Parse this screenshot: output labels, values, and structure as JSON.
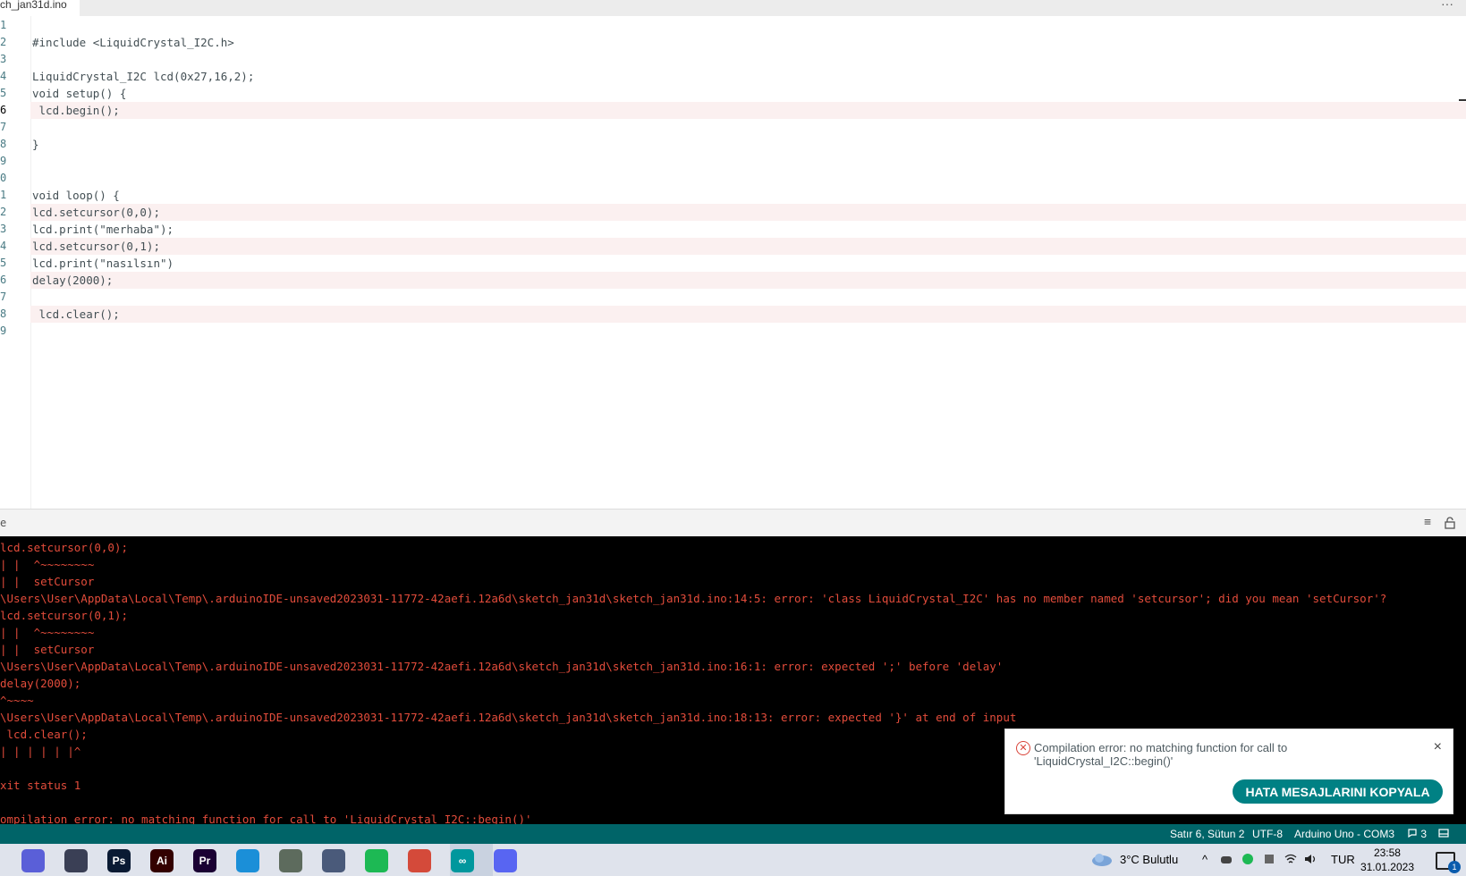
{
  "tab": {
    "filename": "ch_jan31d.ino",
    "more": "···"
  },
  "editor": {
    "line_numbers": [
      "1",
      "2",
      "3",
      "4",
      "5",
      "6",
      "7",
      "8",
      "9",
      "0",
      "1",
      "2",
      "3",
      "4",
      "5",
      "6",
      "7",
      "8",
      "9"
    ],
    "active_line_index": 5,
    "lines": [
      {
        "text": "",
        "highlight": false
      },
      {
        "text": "#include <LiquidCrystal_I2C.h>",
        "highlight": false
      },
      {
        "text": "",
        "highlight": false
      },
      {
        "text": "LiquidCrystal_I2C lcd(0x27,16,2);",
        "highlight": false
      },
      {
        "text": "void setup() {",
        "highlight": false
      },
      {
        "text": " lcd.begin();",
        "highlight": true
      },
      {
        "text": "",
        "highlight": false
      },
      {
        "text": "}",
        "highlight": false
      },
      {
        "text": "",
        "highlight": false
      },
      {
        "text": "",
        "highlight": false
      },
      {
        "text": "void loop() {",
        "highlight": false
      },
      {
        "text": "lcd.setcursor(0,0);",
        "highlight": true
      },
      {
        "text": "lcd.print(\"merhaba\");",
        "highlight": false
      },
      {
        "text": "lcd.setcursor(0,1);",
        "highlight": true
      },
      {
        "text": "lcd.print(\"nasılsın\")",
        "highlight": false
      },
      {
        "text": "delay(2000);",
        "highlight": true
      },
      {
        "text": "",
        "highlight": false
      },
      {
        "text": " lcd.clear();",
        "highlight": true
      },
      {
        "text": "",
        "highlight": false
      }
    ]
  },
  "console_header": {
    "lead": "e",
    "clear_icon": "clear-output-icon",
    "lock_icon": "unlock-icon"
  },
  "console": {
    "lines": [
      "lcd.setcursor(0,0);",
      "| |  ^~~~~~~~~",
      "| |  setCursor",
      "\\Users\\User\\AppData\\Local\\Temp\\.arduinoIDE-unsaved2023031-11772-42aefi.12a6d\\sketch_jan31d\\sketch_jan31d.ino:14:5: error: 'class LiquidCrystal_I2C' has no member named 'setcursor'; did you mean 'setCursor'?",
      "lcd.setcursor(0,1);",
      "| |  ^~~~~~~~~",
      "| |  setCursor",
      "\\Users\\User\\AppData\\Local\\Temp\\.arduinoIDE-unsaved2023031-11772-42aefi.12a6d\\sketch_jan31d\\sketch_jan31d.ino:16:1: error: expected ';' before 'delay'",
      "delay(2000);",
      "^~~~~",
      "\\Users\\User\\AppData\\Local\\Temp\\.arduinoIDE-unsaved2023031-11772-42aefi.12a6d\\sketch_jan31d\\sketch_jan31d.ino:18:13: error: expected '}' at end of input",
      " lcd.clear();",
      "| | | | | |^",
      "",
      "xit status 1",
      "",
      "ompilation error: no matching function for call to 'LiquidCrystal_I2C::begin()'"
    ]
  },
  "toast": {
    "message": "Compilation error: no matching function for call to 'LiquidCrystal_I2C::begin()'",
    "button": "HATA MESAJLARINI KOPYALA",
    "close": "×"
  },
  "status_bar": {
    "position": "Satır 6, Sütun 2",
    "encoding": "UTF-8",
    "board": "Arduino Uno - COM3",
    "notifications": "3"
  },
  "taskbar": {
    "apps": [
      {
        "name": "copilot-icon",
        "label": "",
        "color": "#5a5fd8"
      },
      {
        "name": "davinci-icon",
        "label": "",
        "color": "#3a3f55"
      },
      {
        "name": "photoshop-icon",
        "label": "Ps",
        "color": "#0a1a33"
      },
      {
        "name": "illustrator-icon",
        "label": "Ai",
        "color": "#330000"
      },
      {
        "name": "premiere-icon",
        "label": "Pr",
        "color": "#1a0033"
      },
      {
        "name": "edge-icon",
        "label": "",
        "color": "#1b8fd8"
      },
      {
        "name": "xbox-icon",
        "label": "",
        "color": "#5d6b5d"
      },
      {
        "name": "files-icon",
        "label": "",
        "color": "#4a5a7a"
      },
      {
        "name": "spotify-icon",
        "label": "",
        "color": "#1db954"
      },
      {
        "name": "chrome-icon",
        "label": "",
        "color": "#d44a3a"
      },
      {
        "name": "arduino-icon",
        "label": "∞",
        "color": "#00979d"
      },
      {
        "name": "discord-icon",
        "label": "",
        "color": "#5865f2"
      }
    ],
    "weather": "3°C  Bulutlu",
    "language": "TUR",
    "time": "23:58",
    "date": "31.01.2023",
    "notif_count": "1"
  }
}
